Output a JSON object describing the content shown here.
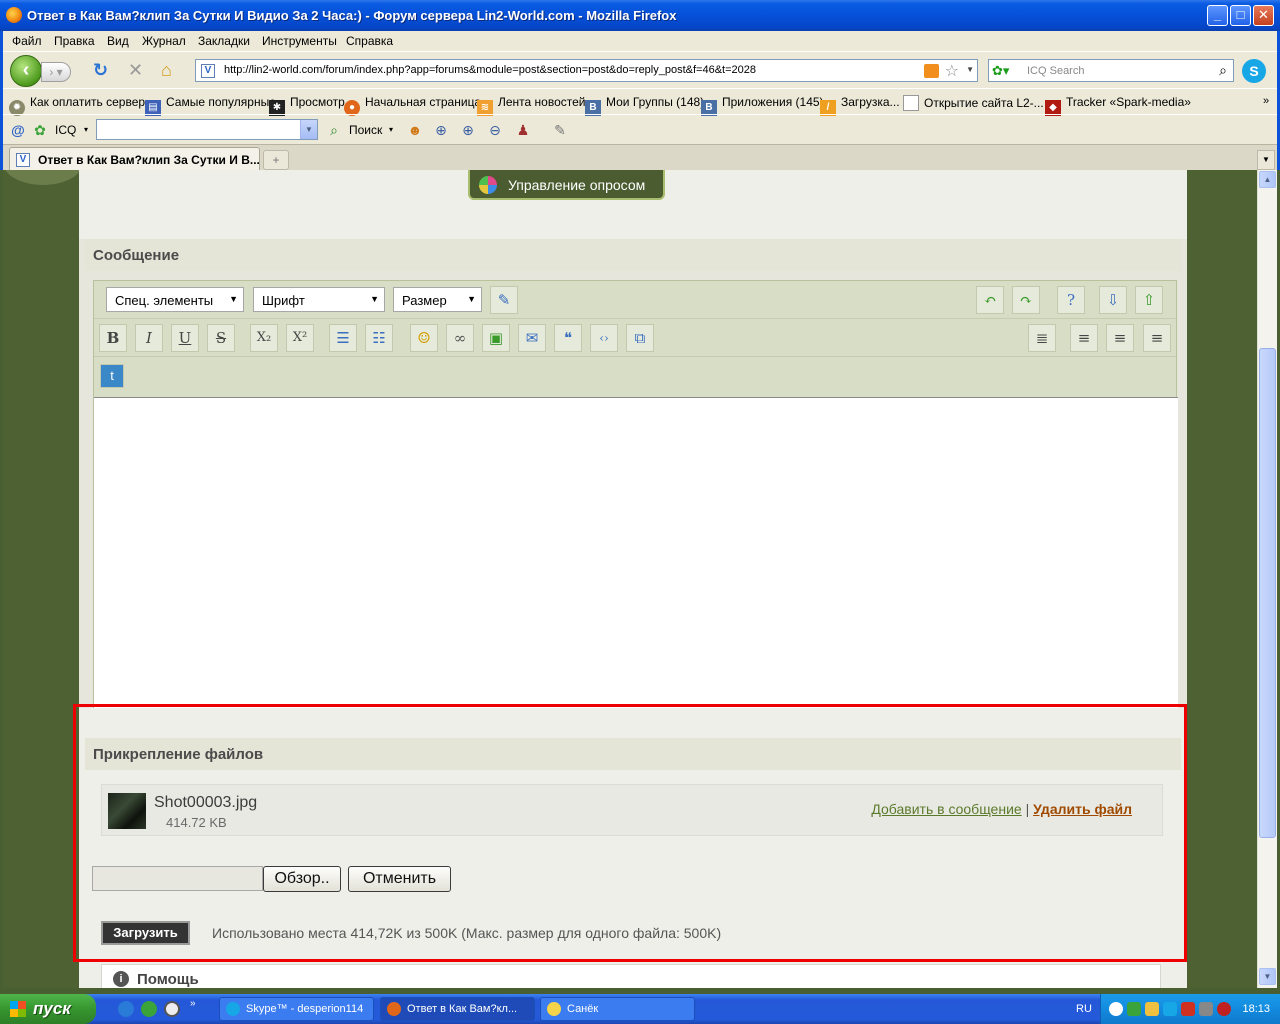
{
  "window": {
    "title": "Ответ в Как Вам?клип За Сутки И Видио За 2 Часа:) - Форум сервера Lin2-World.com - Mozilla Firefox"
  },
  "menu": [
    "Файл",
    "Правка",
    "Вид",
    "Журнал",
    "Закладки",
    "Инструменты",
    "Справка"
  ],
  "nav": {
    "url": "http://lin2-world.com/forum/index.php?app=forums&module=post&section=post&do=reply_post&f=46&t=2028",
    "search_placeholder": "ICQ Search"
  },
  "bookmarks": [
    "Как оплатить сервер",
    "Самые популярные",
    "Просмотр",
    "Начальная страница",
    "Лента новостей",
    "Мои Группы (148)",
    "Приложения (145)",
    "Загрузка...",
    "Открытие сайта L2-...",
    "Tracker «Spark-media»"
  ],
  "icq_toolbar": {
    "icq_label": "ICQ",
    "search_label": "Поиск"
  },
  "tab": {
    "title": "Ответ в Как Вам?клип За Сутки И В..."
  },
  "page": {
    "poll_button": "Управление опросом",
    "message_heading": "Сообщение",
    "editor": {
      "special_select": "Спец. элементы",
      "font_select": "Шрифт",
      "size_select": "Размер"
    },
    "attachments_heading": "Прикрепление файлов",
    "file": {
      "name": "Shot00003.jpg",
      "size": "414.72 KB",
      "add_link": "Добавить в сообщение",
      "separator": "|",
      "delete_link": "Удалить файл"
    },
    "browse_button": "Обзор..",
    "cancel_button": "Отменить",
    "upload_button": "Загрузить",
    "usage_text": "Использовано места 414,72K из 500K (Макс. размер для одного файла: 500K)",
    "help_heading": "Помощь"
  },
  "taskbar": {
    "start": "пуск",
    "tasks": [
      "Skype™ - desperion114",
      "Ответ в Как Вам?кл...",
      "Санёк"
    ],
    "lang": "RU",
    "clock": "18:13"
  }
}
